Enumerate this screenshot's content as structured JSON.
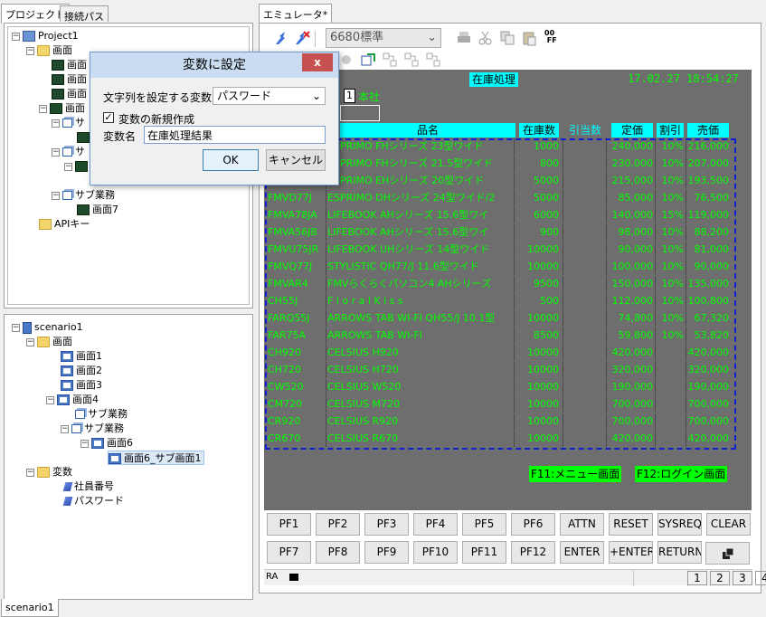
{
  "left_tabs": [
    "プロジェクト",
    "接続パス"
  ],
  "right_tab": "エミュレータ*",
  "bottom_tab": "scenario1",
  "project_tree": {
    "root": "Project1",
    "folder_screens": "画面",
    "item_screen": "画面",
    "sub_business": "サ",
    "sub_business_full": "サブ業務",
    "screen7": "画面7",
    "api_key": "APIキー"
  },
  "scenario_tree": {
    "root": "scenario1",
    "folder_screens": "画面",
    "screens": [
      "画面1",
      "画面2",
      "画面3",
      "画面4"
    ],
    "sub1": "サブ業務",
    "sub2": "サブ業務",
    "screen6": "画面6",
    "screen6_sub": "画面6_サブ画面1",
    "folder_vars": "変数",
    "vars": [
      "社員番号",
      "パスワード"
    ]
  },
  "toolbar": {
    "terminal_select": "6680標準"
  },
  "dialog": {
    "title": "変数に設定",
    "close": "x",
    "string_var_label": "文字列を設定する変数",
    "string_var_value": "パスワード",
    "new_var_checkbox": "変数の新規作成",
    "new_var_checked": true,
    "var_name_label": "変数名",
    "var_name_value": "在庫処理結果",
    "ok": "OK",
    "cancel": "キャンセル"
  },
  "emulator": {
    "title": "在庫処理",
    "datetime": "17.02.27 18:54:27",
    "field_num": "1",
    "branch": "本社",
    "headers": {
      "name": "品名",
      "stock": "在庫数",
      "alloc": "引当数",
      "list_price": "定価",
      "discount": "割引",
      "price": "売価"
    },
    "rows": [
      {
        "code": "",
        "name": "ESPRIMO FHシリーズ 23型ワイド",
        "stock": "1000",
        "alloc": "",
        "list": "240,000",
        "disc": "10%",
        "price": "216,000"
      },
      {
        "code": "",
        "name": "ESPRIMO FHシリーズ 21.5型ワイド",
        "stock": "800",
        "alloc": "",
        "list": "230,000",
        "disc": "10%",
        "price": "207,000"
      },
      {
        "code": "",
        "name": "ESPRIMO EHシリーズ 20型ワイド",
        "stock": "5000",
        "alloc": "",
        "list": "215,000",
        "disc": "10%",
        "price": "193,500"
      },
      {
        "code": "FMVD77J",
        "name": "ESPRIMO DHシリーズ 24型ワイド/2",
        "stock": "5000",
        "alloc": "",
        "list": "85,000",
        "disc": "10%",
        "price": "76,500"
      },
      {
        "code": "FMVA78JA",
        "name": "LIFEBOOK AHシリーズ 15.6型ワイ",
        "stock": "6000",
        "alloc": "",
        "list": "140,000",
        "disc": "15%",
        "price": "119,000"
      },
      {
        "code": "FMVA56JB",
        "name": "LIFEBOOK AHシリーズ 15.6型ワイ",
        "stock": "900",
        "alloc": "",
        "list": "98,000",
        "disc": "10%",
        "price": "88,200"
      },
      {
        "code": "FMVU75JR",
        "name": "LIFEBOOK UHシリーズ 14型ワイド",
        "stock": "10000",
        "alloc": "",
        "list": "90,000",
        "disc": "10%",
        "price": "81,000"
      },
      {
        "code": "FMVQ77J",
        "name": "STYLISTIC QH77/J 11.6型ワイド",
        "stock": "10000",
        "alloc": "",
        "list": "100,000",
        "disc": "10%",
        "price": "90,000"
      },
      {
        "code": "FMVAR4",
        "name": "FMVらくらくパソコン4 AHシリーズ",
        "stock": "9500",
        "alloc": "",
        "list": "150,000",
        "disc": "10%",
        "price": "135,000"
      },
      {
        "code": "CH55J",
        "name": "F l o r a l  K i s s",
        "stock": "500",
        "alloc": "",
        "list": "112,000",
        "disc": "10%",
        "price": "100,800"
      },
      {
        "code": "FARQ55J",
        "name": "ARROWS TAB WI-FI QH55/J 10.1型",
        "stock": "10000",
        "alloc": "",
        "list": "74,800",
        "disc": "10%",
        "price": "67,320"
      },
      {
        "code": "FAR75A",
        "name": "ARROWS TAB WI-FI",
        "stock": "8500",
        "alloc": "",
        "list": "59,800",
        "disc": "10%",
        "price": "53,820"
      },
      {
        "code": "CH920",
        "name": "CELSIUS H920",
        "stock": "10000",
        "alloc": "",
        "list": "420,000",
        "disc": "",
        "price": "420,000"
      },
      {
        "code": "CH720",
        "name": "CELSIUS H720",
        "stock": "10000",
        "alloc": "",
        "list": "320,000",
        "disc": "",
        "price": "320,000"
      },
      {
        "code": "CW520",
        "name": "CELSIUS W520",
        "stock": "10000",
        "alloc": "",
        "list": "190,000",
        "disc": "",
        "price": "190,000"
      },
      {
        "code": "CM720",
        "name": "CELSIUS M720",
        "stock": "10000",
        "alloc": "",
        "list": "700,000",
        "disc": "",
        "price": "700,000"
      },
      {
        "code": "CR920",
        "name": "CELSIUS R920",
        "stock": "10000",
        "alloc": "",
        "list": "700,000",
        "disc": "",
        "price": "700,000"
      },
      {
        "code": "CR670",
        "name": "CELSIUS R670",
        "stock": "10000",
        "alloc": "",
        "list": "420,000",
        "disc": "",
        "price": "420,000"
      }
    ],
    "f11": "F11:メニュー画面",
    "f12": "F12:ログイン画面"
  },
  "pf_row1": [
    "PF1",
    "PF2",
    "PF3",
    "PF4",
    "PF5",
    "PF6",
    "ATTN",
    "RESET",
    "SYSREQ",
    "CLEAR"
  ],
  "pf_row2": [
    "PF7",
    "PF8",
    "PF9",
    "PF10",
    "PF11",
    "PF12",
    "ENTER",
    "+ENTER",
    "RETURN"
  ],
  "status": {
    "mode": "RA",
    "pages": [
      "1",
      "2",
      "3",
      "4"
    ]
  },
  "colors": {
    "emu_bg": "#6e6e6e",
    "green": "#00ff00",
    "cyan": "#00ffff"
  }
}
